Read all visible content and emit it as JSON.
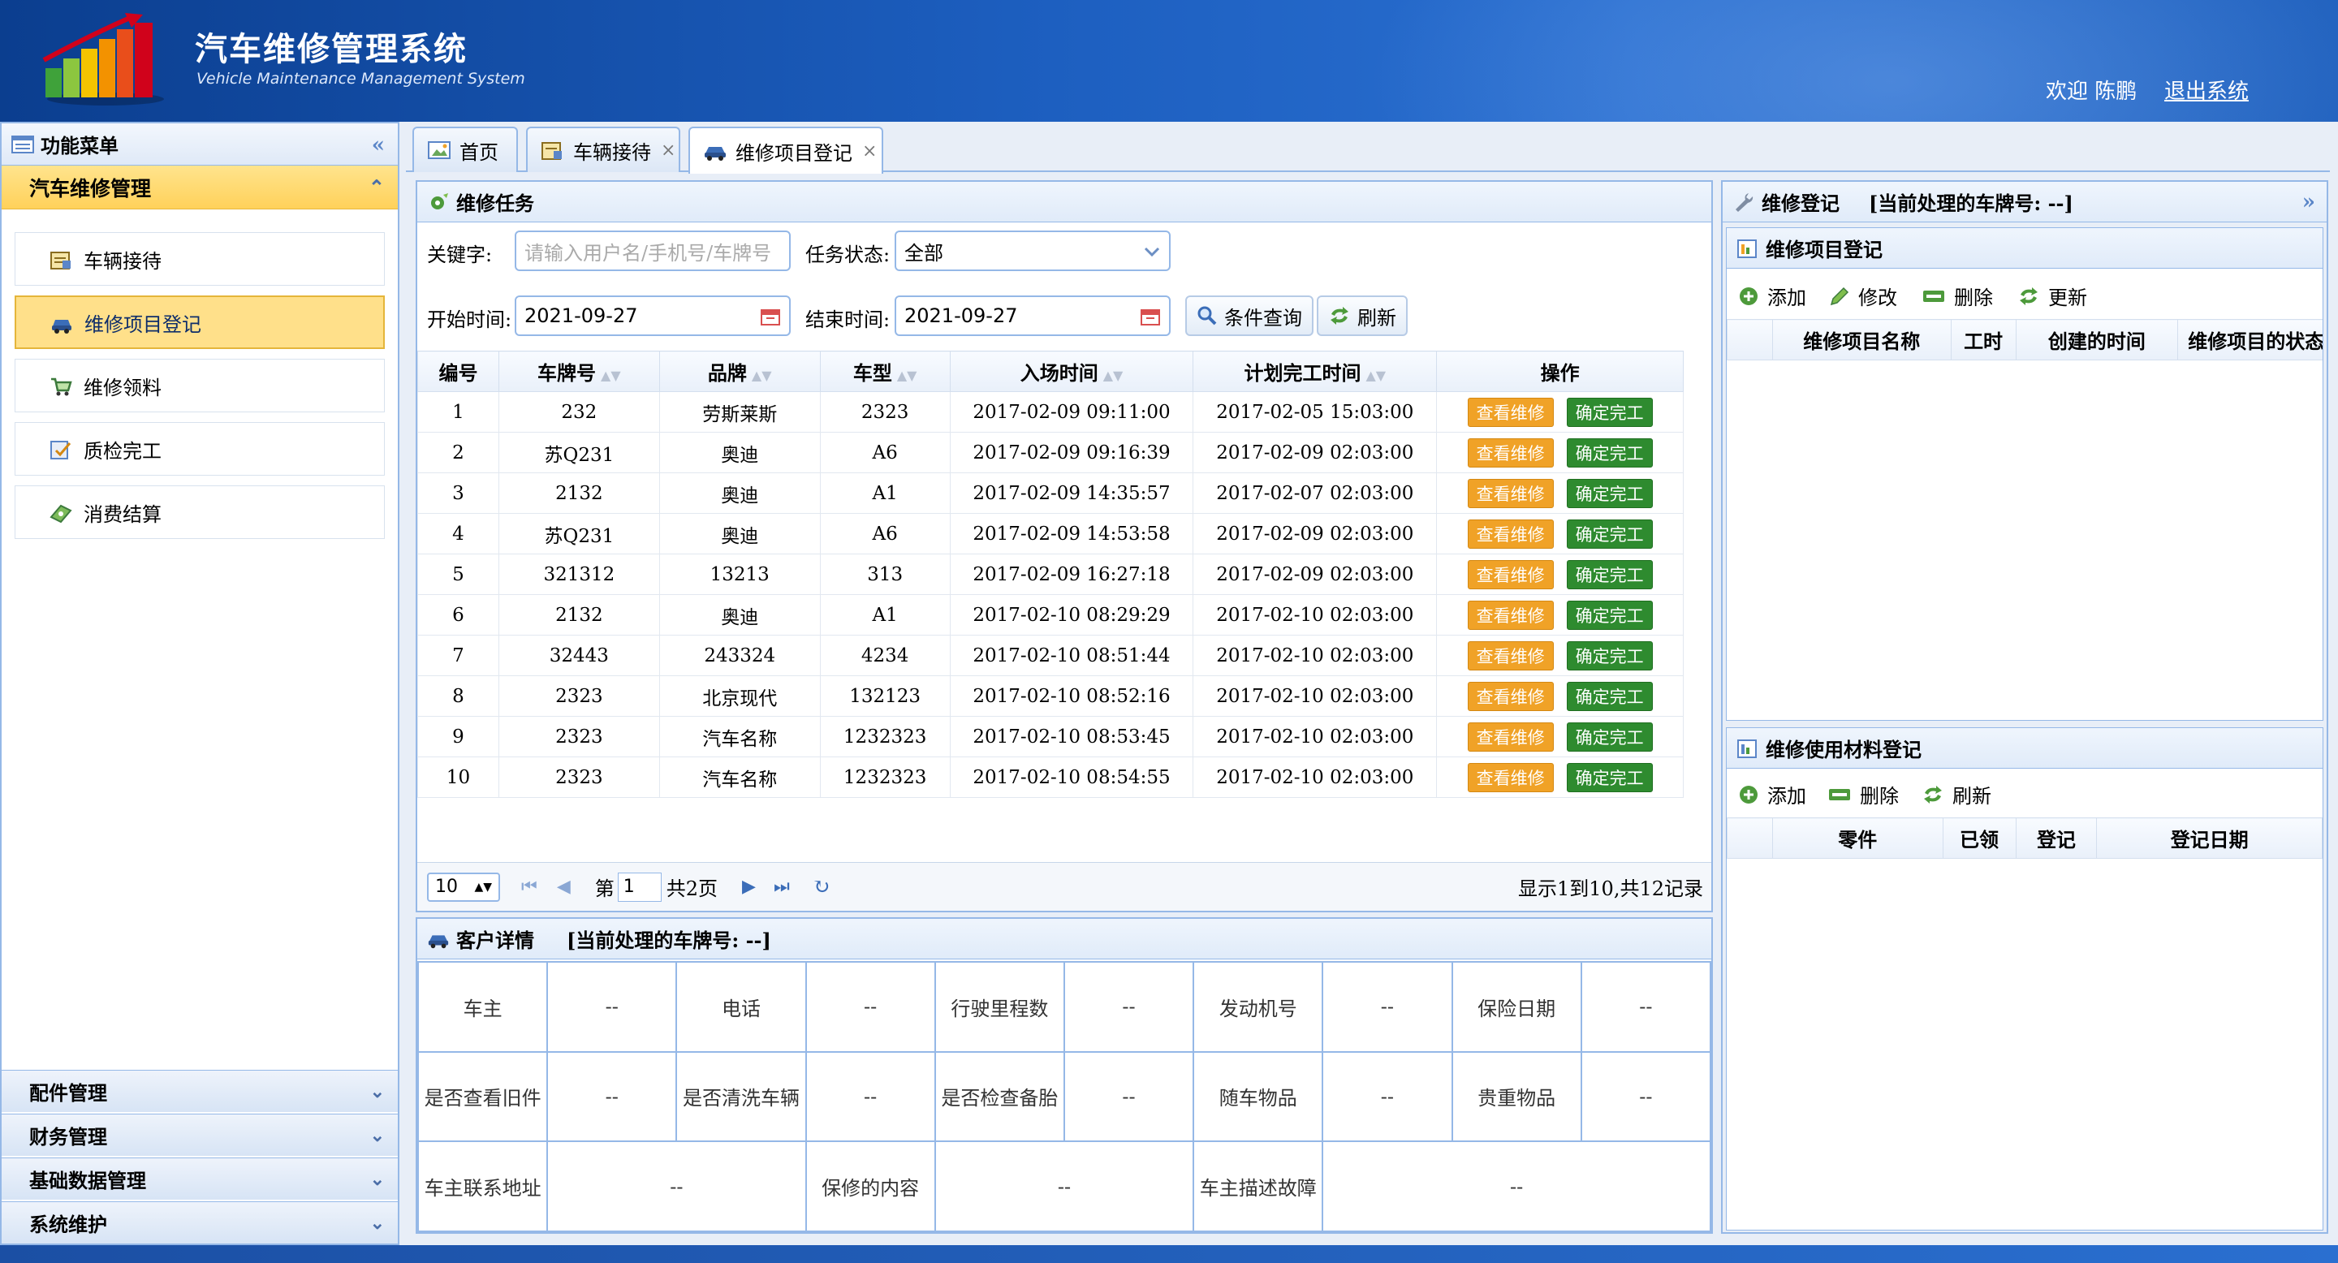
{
  "header": {
    "title": "汽车维修管理系统",
    "subtitle": "Vehicle Maintenance Management System",
    "welcome": "欢迎 陈鹏",
    "logout": "退出系统"
  },
  "sidebar": {
    "title": "功能菜单",
    "active_section": "汽车维修管理",
    "items": [
      {
        "label": "车辆接待",
        "icon": "notepad-icon"
      },
      {
        "label": "维修项目登记",
        "icon": "car-icon"
      },
      {
        "label": "维修领料",
        "icon": "cart-icon"
      },
      {
        "label": "质检完工",
        "icon": "check-icon"
      },
      {
        "label": "消费结算",
        "icon": "money-icon"
      }
    ],
    "collapsed_sections": [
      "配件管理",
      "财务管理",
      "基础数据管理",
      "系统维护"
    ]
  },
  "tabs": [
    {
      "label": "首页",
      "closable": false
    },
    {
      "label": "车辆接待",
      "closable": true
    },
    {
      "label": "维修项目登记",
      "closable": true,
      "active": true
    }
  ],
  "tasks": {
    "title": "维修任务",
    "keyword_label": "关键字:",
    "keyword_placeholder": "请输入用户名/手机号/车牌号",
    "status_label": "任务状态:",
    "status_value": "全部",
    "start_label": "开始时间:",
    "start_value": "2021-09-27",
    "end_label": "结束时间:",
    "end_value": "2021-09-27",
    "query_button": "条件查询",
    "refresh_button": "刷新",
    "columns": [
      "编号",
      "车牌号",
      "品牌",
      "车型",
      "入场时间",
      "计划完工时间",
      "操作"
    ],
    "view_button": "查看维修",
    "done_button": "确定完工",
    "rows": [
      [
        "1",
        "232",
        "劳斯莱斯",
        "2323",
        "2017-02-09 09:11:00",
        "2017-02-05 15:03:00"
      ],
      [
        "2",
        "苏Q231",
        "奥迪",
        "A6",
        "2017-02-09 09:16:39",
        "2017-02-09 02:03:00"
      ],
      [
        "3",
        "2132",
        "奥迪",
        "A1",
        "2017-02-09 14:35:57",
        "2017-02-07 02:03:00"
      ],
      [
        "4",
        "苏Q231",
        "奥迪",
        "A6",
        "2017-02-09 14:53:58",
        "2017-02-09 02:03:00"
      ],
      [
        "5",
        "321312",
        "13213",
        "313",
        "2017-02-09 16:27:18",
        "2017-02-09 02:03:00"
      ],
      [
        "6",
        "2132",
        "奥迪",
        "A1",
        "2017-02-10 08:29:29",
        "2017-02-10 02:03:00"
      ],
      [
        "7",
        "32443",
        "243324",
        "4234",
        "2017-02-10 08:51:44",
        "2017-02-10 02:03:00"
      ],
      [
        "8",
        "2323",
        "北京现代",
        "132123",
        "2017-02-10 08:52:16",
        "2017-02-10 02:03:00"
      ],
      [
        "9",
        "2323",
        "汽车名称",
        "1232323",
        "2017-02-10 08:53:45",
        "2017-02-10 02:03:00"
      ],
      [
        "10",
        "2323",
        "汽车名称",
        "1232323",
        "2017-02-10 08:54:55",
        "2017-02-10 02:03:00"
      ]
    ],
    "pager": {
      "page_size": "10",
      "page_prefix": "第",
      "page_value": "1",
      "page_total": "共2页",
      "summary": "显示1到10,共12记录"
    }
  },
  "customer": {
    "title": "客户详情",
    "current_plate": "[当前处理的车牌号: --]",
    "rows": [
      [
        "车主",
        "--",
        "电话",
        "--",
        "行驶里程数",
        "--",
        "发动机号",
        "--",
        "保险日期",
        "--"
      ],
      [
        "是否查看旧件",
        "--",
        "是否清洗车辆",
        "--",
        "是否检查备胎",
        "--",
        "随车物品",
        "--",
        "贵重物品",
        "--"
      ]
    ],
    "last_row": [
      "车主联系地址",
      "--",
      "保修的内容",
      "--",
      "车主描述故障",
      "--"
    ]
  },
  "registration": {
    "title": "维修登记",
    "current_plate": "[当前处理的车牌号: --]",
    "items_title": "维修项目登记",
    "items_toolbar": [
      "添加",
      "修改",
      "删除",
      "更新"
    ],
    "items_columns": [
      "维修项目名称",
      "工时",
      "创建的时间",
      "维修项目的状态"
    ],
    "materials_title": "维修使用材料登记",
    "materials_toolbar": [
      "添加",
      "删除",
      "刷新"
    ],
    "materials_columns": [
      "零件",
      "已领",
      "登记",
      "登记日期"
    ]
  },
  "colors": {
    "header": "#1d5fc0",
    "active_menu": "#ffe08a",
    "border": "#95b8e7",
    "view_button": "#f0a227",
    "done_button": "#2e8b2f"
  }
}
